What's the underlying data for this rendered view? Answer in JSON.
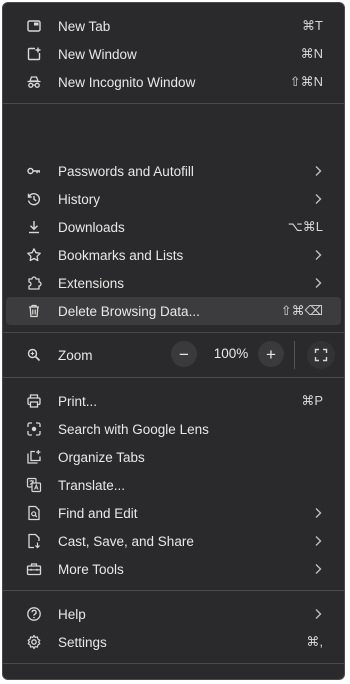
{
  "menu": {
    "new_tab": {
      "label": "New Tab",
      "shortcut": "⌘T"
    },
    "new_window": {
      "label": "New Window",
      "shortcut": "⌘N"
    },
    "new_incognito": {
      "label": "New Incognito Window",
      "shortcut": "⇧⌘N"
    },
    "passwords": {
      "label": "Passwords and Autofill"
    },
    "history": {
      "label": "History"
    },
    "downloads": {
      "label": "Downloads",
      "shortcut": "⌥⌘L"
    },
    "bookmarks": {
      "label": "Bookmarks and Lists"
    },
    "extensions": {
      "label": "Extensions"
    },
    "delete_data": {
      "label": "Delete Browsing Data...",
      "shortcut": "⇧⌘⌫"
    },
    "zoom": {
      "label": "Zoom",
      "value": "100%",
      "minus": "−",
      "plus": "+"
    },
    "print": {
      "label": "Print...",
      "shortcut": "⌘P"
    },
    "google_lens": {
      "label": "Search with Google Lens"
    },
    "organize_tabs": {
      "label": "Organize Tabs"
    },
    "translate": {
      "label": "Translate..."
    },
    "find_edit": {
      "label": "Find and Edit"
    },
    "cast_save": {
      "label": "Cast, Save, and Share"
    },
    "more_tools": {
      "label": "More Tools"
    },
    "help": {
      "label": "Help"
    },
    "settings": {
      "label": "Settings",
      "shortcut": "⌘,"
    }
  },
  "colors": {
    "menu_bg": "#2a2a2c",
    "highlight": "#3c3c3e",
    "text": "#e8e8e8",
    "separator": "#4a4a4c"
  }
}
